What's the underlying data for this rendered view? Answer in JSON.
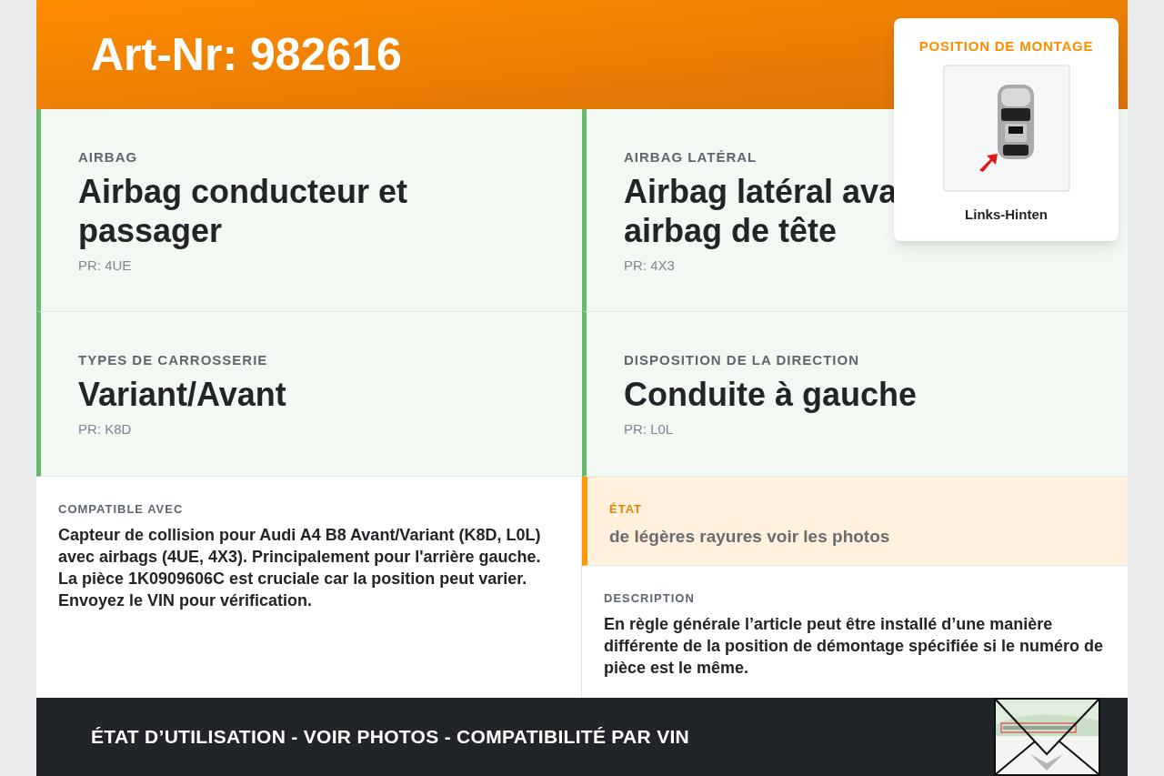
{
  "header": {
    "title": "Art-Nr: 982616"
  },
  "mount_card": {
    "title": "POSITION DE MONTAGE",
    "caption": "Links-Hinten"
  },
  "specs": [
    {
      "label": "AIRBAG",
      "value": "Airbag conducteur et passager",
      "code": "PR: 4UE"
    },
    {
      "label": "AIRBAG LATÉRAL",
      "value": "Airbag latéral ava\nairbag de tête",
      "code": "PR: 4X3"
    },
    {
      "label": "TYPES DE CARROSSERIE",
      "value": "Variant/Avant",
      "code": "PR: K8D"
    },
    {
      "label": "DISPOSITION DE LA DIRECTION",
      "value": "Conduite à gauche",
      "code": "PR: L0L"
    }
  ],
  "compatible": {
    "label": "COMPATIBLE AVEC",
    "text": "Capteur de collision pour Audi A4 B8 Avant/Variant (K8D, L0L) avec airbags (4UE, 4X3). Principalement pour l'arrière gauche. La pièce 1K0909606C est cruciale car la position peut varier. Envoyez le VIN pour vérification."
  },
  "condition": {
    "label": "ÉTAT",
    "text": "de légères rayures voir les photos"
  },
  "description": {
    "label": "DESCRIPTION",
    "text": "En règle générale l’article peut être installé d’une manière différente de la position de démontage spécifiée si le numéro de pièce est le même."
  },
  "footer": {
    "text": "ÉTAT D’UTILISATION - VOIR PHOTOS - COMPATIBILITÉ PAR VIN"
  }
}
